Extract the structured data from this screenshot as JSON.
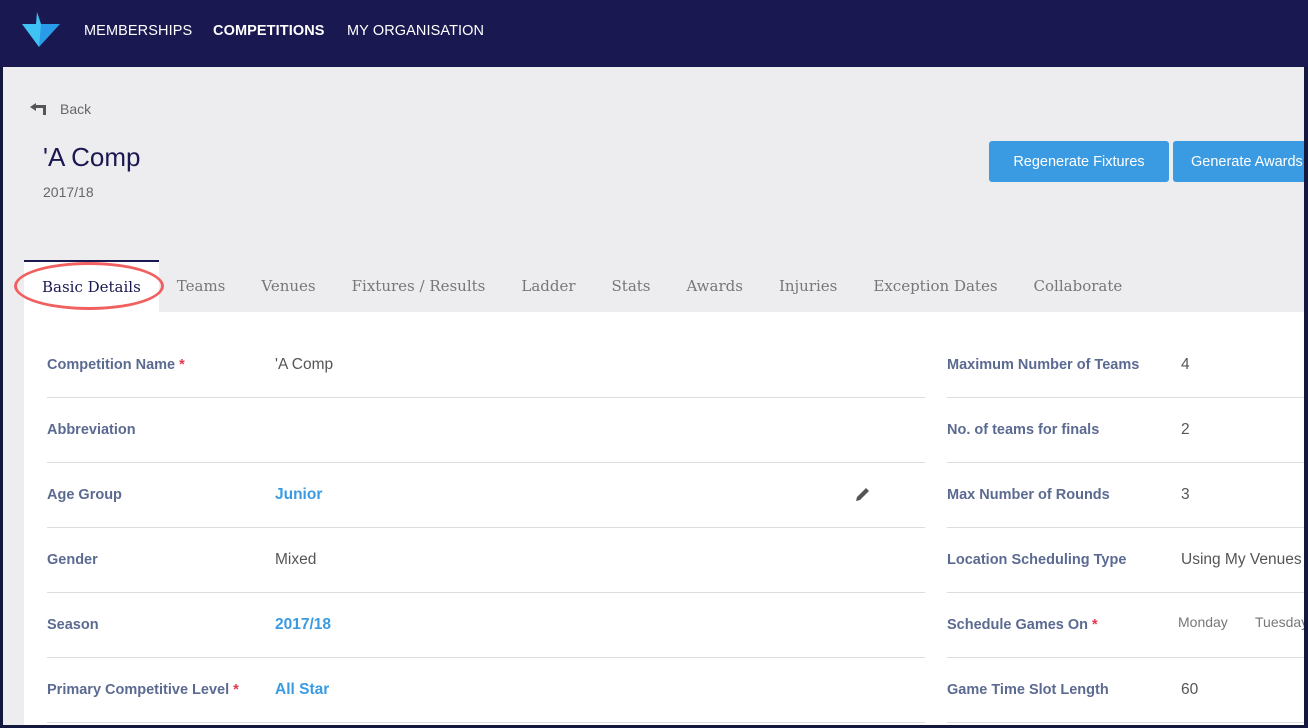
{
  "nav": {
    "items": [
      "MEMBERSHIPS",
      "COMPETITIONS",
      "MY ORGANISATION"
    ],
    "active": "COMPETITIONS"
  },
  "header": {
    "back": "Back",
    "title": "'A Comp",
    "season": "2017/18"
  },
  "buttons": {
    "regenerate": "Regenerate Fixtures",
    "awards": "Generate Awards"
  },
  "tabs": [
    "Basic Details",
    "Teams",
    "Venues",
    "Fixtures / Results",
    "Ladder",
    "Stats",
    "Awards",
    "Injuries",
    "Exception Dates",
    "Collaborate"
  ],
  "left_fields": [
    {
      "label": "Competition Name",
      "required": "*",
      "value": "'A Comp"
    },
    {
      "label": "Abbreviation",
      "value": ""
    },
    {
      "label": "Age Group",
      "value": "Junior"
    },
    {
      "label": "Gender",
      "value": "Mixed"
    },
    {
      "label": "Season",
      "value": "2017/18"
    },
    {
      "label": "Primary Competitive Level",
      "required": "*",
      "value": "All Star"
    }
  ],
  "right_fields": [
    {
      "label": "Maximum Number of Teams",
      "value": "4"
    },
    {
      "label": "No. of teams for finals",
      "value": "2"
    },
    {
      "label": "Max Number of Rounds",
      "value": "3"
    },
    {
      "label": "Location Scheduling Type",
      "value": "Using My Venues"
    },
    {
      "label": "Schedule Games On",
      "required": "*",
      "days": [
        "Monday",
        "Tuesday"
      ]
    },
    {
      "label": "Game Time Slot Length",
      "value": "60"
    }
  ],
  "colors": {
    "nav_bg": "#1a1850",
    "accent": "#3a9be3",
    "annotation": "#f06060"
  }
}
